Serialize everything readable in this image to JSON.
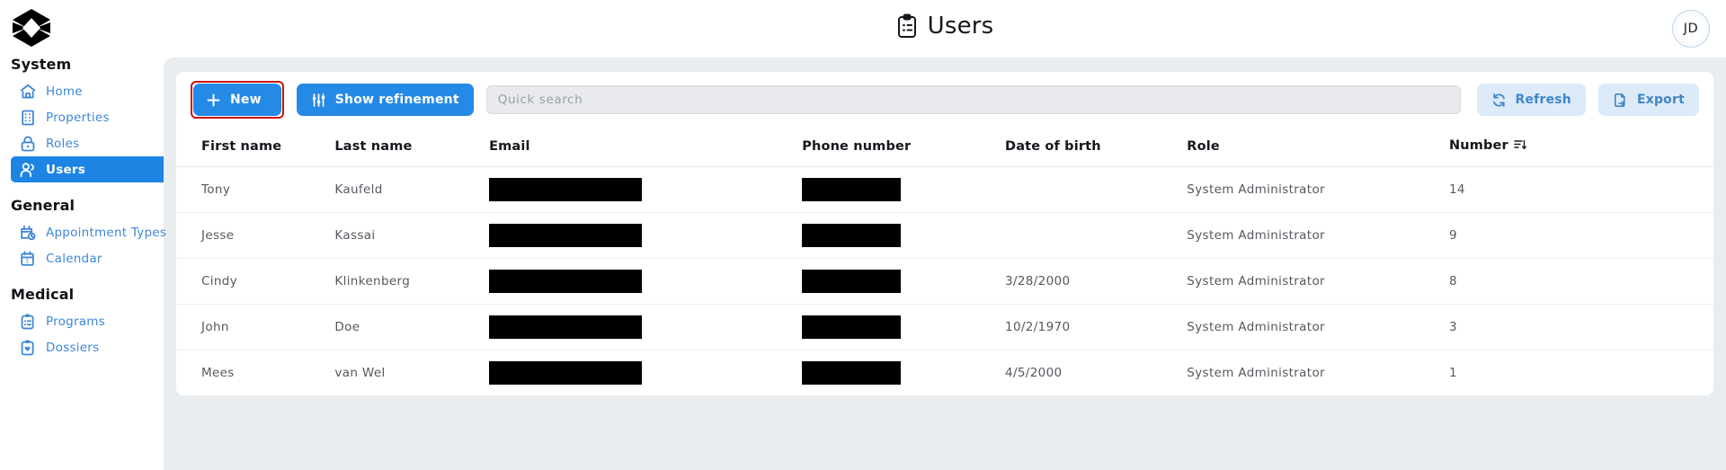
{
  "header": {
    "title": "Users",
    "title_icon": "clipboard-list-icon",
    "avatar_initials": "JD"
  },
  "sidebar": {
    "logo_icon": "hexagon-x-logo",
    "groups": [
      {
        "title": "System",
        "items": [
          {
            "label": "Home",
            "icon": "home-icon",
            "active": false
          },
          {
            "label": "Properties",
            "icon": "building-icon",
            "active": false
          },
          {
            "label": "Roles",
            "icon": "lock-icon",
            "active": false
          },
          {
            "label": "Users",
            "icon": "users-icon",
            "active": true
          }
        ]
      },
      {
        "title": "General",
        "items": [
          {
            "label": "Appointment Types",
            "icon": "calendar-clock-icon",
            "active": false
          },
          {
            "label": "Calendar",
            "icon": "calendar-icon",
            "active": false
          }
        ]
      },
      {
        "title": "Medical",
        "items": [
          {
            "label": "Programs",
            "icon": "clipboard-list-icon",
            "active": false
          },
          {
            "label": "Dossiers",
            "icon": "clipboard-heart-icon",
            "active": false
          }
        ]
      }
    ]
  },
  "toolbar": {
    "new_label": "New",
    "new_icon": "plus-icon",
    "refinement_label": "Show refinement",
    "refinement_icon": "sliders-icon",
    "refresh_label": "Refresh",
    "refresh_icon": "refresh-icon",
    "export_label": "Export",
    "export_icon": "file-export-icon"
  },
  "search": {
    "placeholder": "Quick search",
    "value": ""
  },
  "table": {
    "columns": [
      {
        "label": "First name",
        "key": "first_name"
      },
      {
        "label": "Last name",
        "key": "last_name"
      },
      {
        "label": "Email",
        "key": "email"
      },
      {
        "label": "Phone number",
        "key": "phone"
      },
      {
        "label": "Date of birth",
        "key": "dob"
      },
      {
        "label": "Role",
        "key": "role"
      },
      {
        "label": "Number",
        "key": "number",
        "sort_icon": "sort-descending-icon"
      }
    ],
    "rows": [
      {
        "first_name": "Tony",
        "last_name": "Kaufeld",
        "email": "[redacted]",
        "phone": "[redacted]",
        "dob": "",
        "role": "System Administrator",
        "number": "14"
      },
      {
        "first_name": "Jesse",
        "last_name": "Kassai",
        "email": "[redacted]",
        "phone": "[redacted]",
        "dob": "",
        "role": "System Administrator",
        "number": "9"
      },
      {
        "first_name": "Cindy",
        "last_name": "Klinkenberg",
        "email": "[redacted]",
        "phone": "[redacted]",
        "dob": "3/28/2000",
        "role": "System Administrator",
        "number": "8"
      },
      {
        "first_name": "John",
        "last_name": "Doe",
        "email": "[redacted]",
        "phone": "[redacted]",
        "dob": "10/2/1970",
        "role": "System Administrator",
        "number": "3"
      },
      {
        "first_name": "Mees",
        "last_name": "van Wel",
        "email": "[redacted]",
        "phone": "[redacted]",
        "dob": "4/5/2000",
        "role": "System Administrator",
        "number": "1"
      }
    ]
  },
  "colors": {
    "accent": "#2589e6",
    "accent_soft": "#ddebf8",
    "nav_link": "#3e87d6",
    "panel_bg": "#e9edf0",
    "highlight_border": "#cc1111"
  }
}
